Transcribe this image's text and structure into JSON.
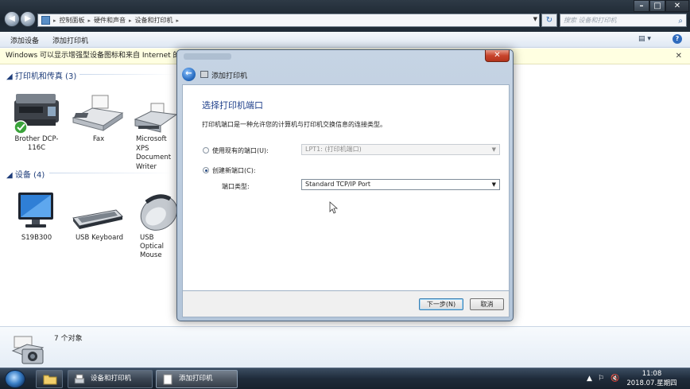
{
  "explorer": {
    "breadcrumb": [
      "控制面板",
      "硬件和声音",
      "设备和打印机"
    ],
    "search_placeholder": "搜索 设备和打印机",
    "toolbar": {
      "add_device": "添加设备",
      "add_printer": "添加打印机"
    },
    "infobar": "Windows 可以显示增强型设备图标和来自 Internet 的信息。",
    "groups": [
      {
        "title": "打印机和传真 (3)",
        "items": [
          "Brother DCP-116C",
          "Fax",
          "Microsoft XPS Document Writer"
        ]
      },
      {
        "title": "设备 (4)",
        "items": [
          "S19B300",
          "USB Keyboard",
          "USB Optical Mouse"
        ]
      }
    ],
    "details": {
      "count": "7 个对象"
    }
  },
  "dialog": {
    "header_title": "添加打印机",
    "heading": "选择打印机端口",
    "description": "打印机端口是一种允许您的计算机与打印机交换信息的连接类型。",
    "option_existing": "使用现有的端口(U):",
    "existing_value": "LPT1: (打印机端口)",
    "option_new": "创建新端口(C):",
    "port_type_label": "端口类型:",
    "port_type_value": "Standard TCP/IP Port",
    "next_button": "下一步(N)",
    "cancel_button": "取消"
  },
  "taskbar": {
    "windows": [
      "设备和打印机",
      "添加打印机"
    ],
    "clock_time": "11:08",
    "clock_date": "2018.07.星期四"
  }
}
